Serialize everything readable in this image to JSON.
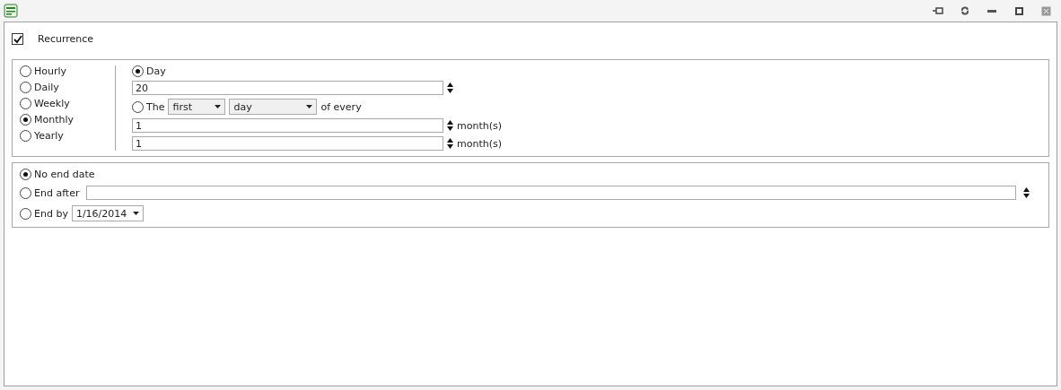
{
  "recurrence": {
    "label": "Recurrence",
    "checked": true
  },
  "patterns": [
    {
      "label": "Hourly",
      "selected": false
    },
    {
      "label": "Daily",
      "selected": false
    },
    {
      "label": "Weekly",
      "selected": false
    },
    {
      "label": "Monthly",
      "selected": true
    },
    {
      "label": "Yearly",
      "selected": false
    }
  ],
  "monthly": {
    "day_option": {
      "label": "Day",
      "selected": true
    },
    "day_value": "20",
    "the_option": {
      "label": "The",
      "selected": false
    },
    "ordinal": "first",
    "weekday": "day",
    "of_every": "of every",
    "intervals": [
      {
        "value": "1",
        "unit": "month(s)"
      },
      {
        "value": "1",
        "unit": "month(s)"
      }
    ]
  },
  "range": {
    "options": [
      {
        "label": "No end date",
        "selected": true,
        "kind": "plain"
      },
      {
        "label": "End after",
        "selected": false,
        "kind": "count"
      },
      {
        "label": "End by",
        "selected": false,
        "kind": "date"
      }
    ],
    "end_by_date": "1/16/2014"
  }
}
